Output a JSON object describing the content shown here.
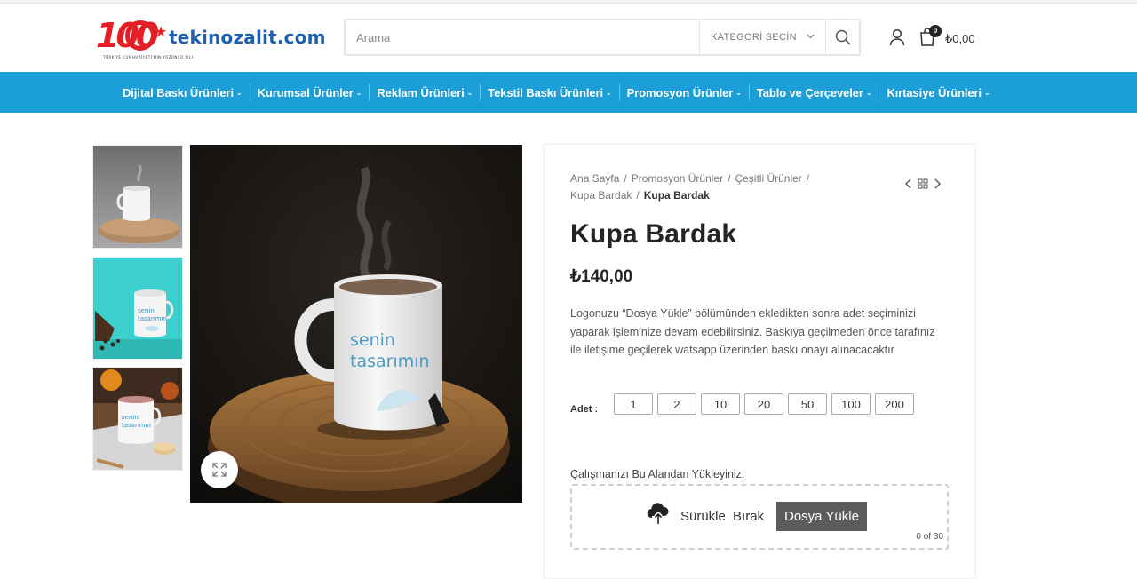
{
  "header": {
    "logo": {
      "mark": "100",
      "site": "tekinozalit.com",
      "tagline": "TÜRKİYE CUMHURİYETİ'NİN YÜZÜNCÜ YILI"
    },
    "search": {
      "placeholder": "Arama",
      "category_label": "KATEGORİ SEÇİN"
    },
    "cart": {
      "count": "0",
      "total": "₺0,00"
    }
  },
  "nav": {
    "items": [
      {
        "label": "Dijital Baskı Ürünleri"
      },
      {
        "label": "Kurumsal Ürünler"
      },
      {
        "label": "Reklam Ürünleri"
      },
      {
        "label": "Tekstil Baskı Ürünleri"
      },
      {
        "label": "Promosyon Ürünler"
      },
      {
        "label": "Tablo ve Çerçeveler"
      },
      {
        "label": "Kırtasiye Ürünleri"
      }
    ]
  },
  "gallery": {
    "mug_print_line1": "senin",
    "mug_print_line2": "tasarımın"
  },
  "product": {
    "breadcrumbs": [
      "Ana Sayfa",
      "Promosyon Ürünler",
      "Çeşitli Ürünler",
      "Kupa Bardak",
      "Kupa Bardak"
    ],
    "title": "Kupa Bardak",
    "price": "₺140,00",
    "description": "Logonuzu “Dosya Yükle” bölümünden ekledikten sonra adet seçiminizi yaparak işleminize devam edebilirsiniz. Baskıya geçilmeden önce tarafınız ile iletişime geçilerek watsapp üzerinden baskı onayı alınacacaktır",
    "quantity_label": "Adet :",
    "quantities": [
      "1",
      "2",
      "10",
      "20",
      "50",
      "100",
      "200"
    ],
    "upload": {
      "label": "Çalışmanızı Bu Alandan Yükleyiniz.",
      "drop_text": "Sürükle Bırak",
      "button_label": "Dosya Yükle",
      "counter": "0 of 30"
    }
  },
  "colors": {
    "nav_bg": "#1c9ed9",
    "logo_red": "#e31e24",
    "logo_blue": "#1f5fb0"
  }
}
